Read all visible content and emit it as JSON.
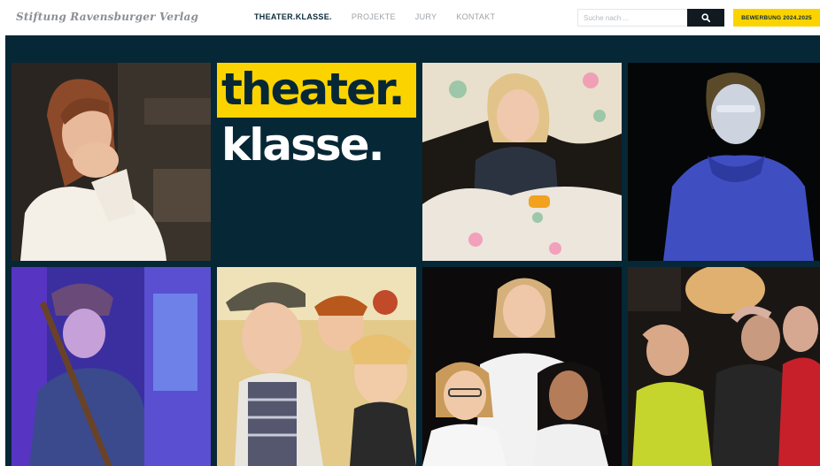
{
  "header": {
    "brand": "Stiftung Ravensburger Verlag",
    "nav": [
      {
        "label": "THEATER.KLASSE.",
        "active": true
      },
      {
        "label": "PROJEKTE",
        "active": false
      },
      {
        "label": "JURY",
        "active": false
      },
      {
        "label": "KONTAKT",
        "active": false
      }
    ],
    "search": {
      "placeholder": "Suche nach ...",
      "icon": "search-icon"
    },
    "cta_label": "BEWERBUNG 2024.2025"
  },
  "hero": {
    "logo": {
      "line1": "theater.",
      "line2": "klasse."
    },
    "photos": [
      {
        "name": "photo-girl-surprised"
      },
      {
        "name": "photo-girl-with-blanket"
      },
      {
        "name": "photo-boy-blue-hoodie"
      },
      {
        "name": "photo-child-with-broom"
      },
      {
        "name": "photo-boy-with-cap"
      },
      {
        "name": "photo-three-girls"
      },
      {
        "name": "photo-kids-hands-up"
      }
    ]
  },
  "colors": {
    "navy": "#062736",
    "yellow": "#fbd400"
  }
}
